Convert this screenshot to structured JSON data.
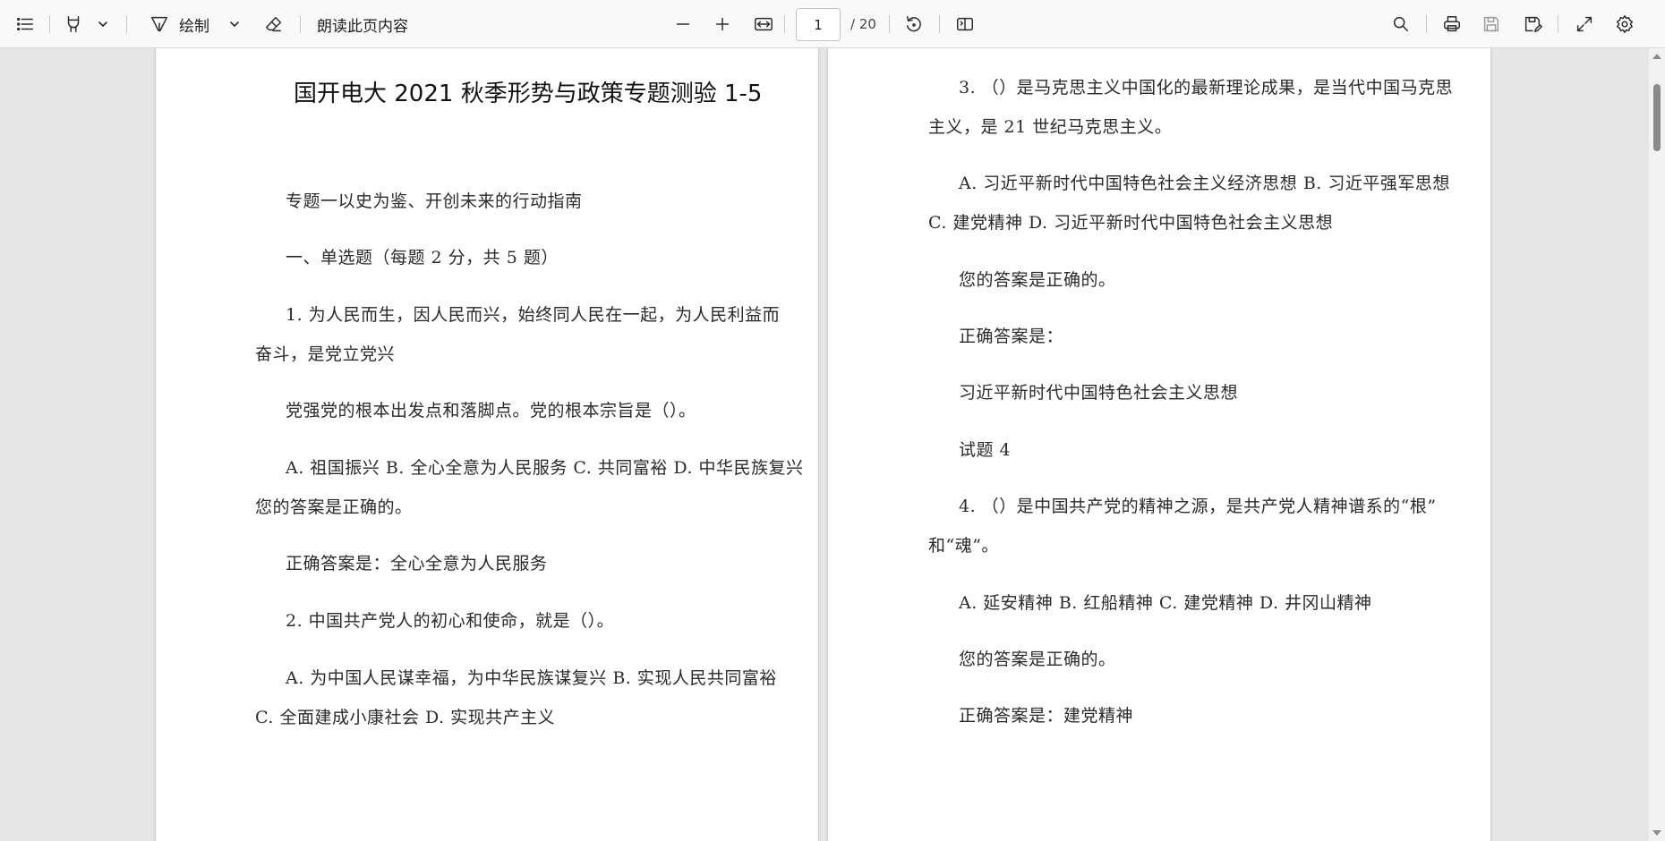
{
  "toolbar": {
    "draw_label": "绘制",
    "read_aloud_label": "朗读此页内容",
    "page_current": "1",
    "page_total": "/ 20",
    "icons": [
      "contents-icon",
      "highlight-icon",
      "draw-icon",
      "eraser-icon",
      "zoom-out-icon",
      "zoom-in-icon",
      "fit-width-icon",
      "rotate-icon",
      "page-view-icon",
      "search-icon",
      "print-icon",
      "save-icon",
      "save-as-icon",
      "fullscreen-icon",
      "settings-icon"
    ]
  },
  "pages": {
    "left": {
      "lines": [
        "国开电大 2021 秋季形势与政策专题测验 1-5",
        "专题一以史为鉴、开创未来的行动指南",
        "一、单选题（每题 2 分，共 5 题）",
        "1. 为人民而生，因人民而兴，始终同人民在一起，为人民利益而",
        "奋斗，是党立党兴",
        "党强党的根本出发点和落脚点。党的根本宗旨是（）。",
        "A. 祖国振兴 B. 全心全意为人民服务 C. 共同富裕 D. 中华民族复兴",
        "您的答案是正确的。",
        "正确答案是：全心全意为人民服务",
        "2. 中国共产党人的初心和使命，就是（）。",
        "A. 为中国人民谋幸福，为中华民族谋复兴 B. 实现人民共同富裕",
        "C. 全面建成小康社会 D. 实现共产主义"
      ]
    },
    "right": {
      "lines": [
        "3. （）是马克思主义中国化的最新理论成果，是当代中国马克思",
        "主义，是 21 世纪马克思主义。",
        "A. 习近平新时代中国特色社会主义经济思想 B. 习近平强军思想",
        "C. 建党精神 D. 习近平新时代中国特色社会主义思想",
        "您的答案是正确的。",
        "正确答案是：",
        "习近平新时代中国特色社会主义思想",
        "试题 4",
        "4. （）是中国共产党的精神之源，是共产党人精神谱系的“根”",
        "和“魂”。",
        "A. 延安精神 B. 红船精神 C. 建党精神 D. 井冈山精神",
        "您的答案是正确的。",
        "正确答案是：建党精神"
      ]
    }
  }
}
